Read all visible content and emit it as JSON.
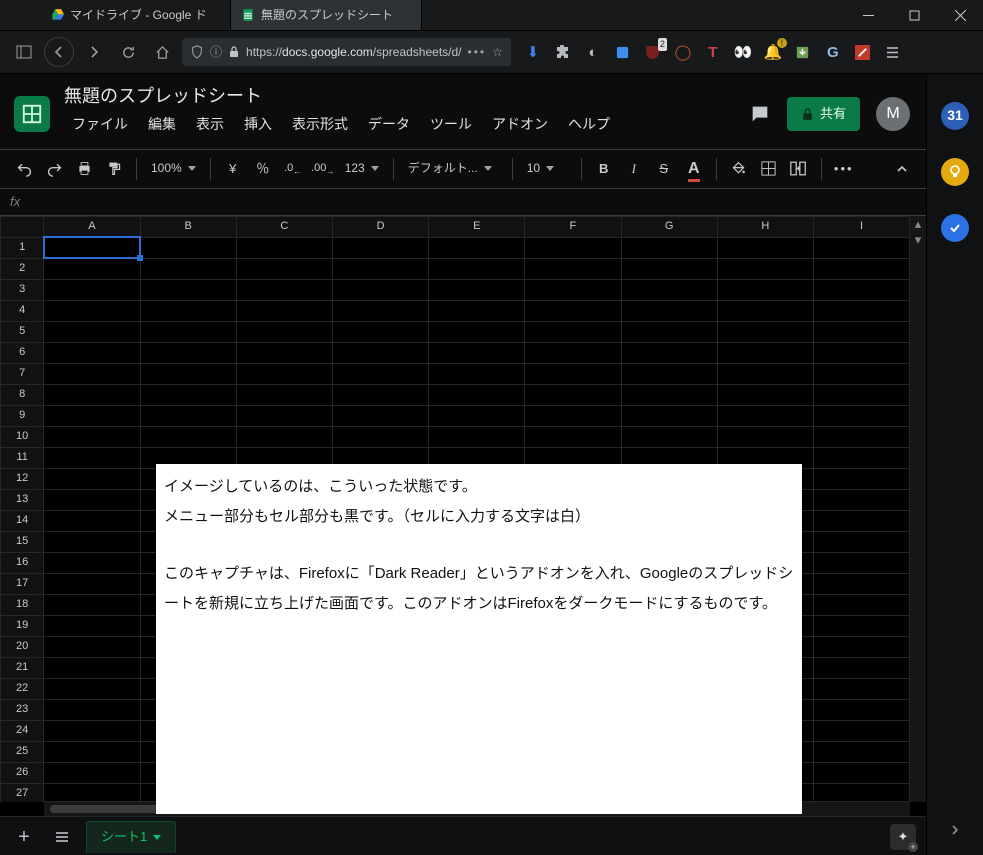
{
  "window": {
    "tabs": [
      {
        "label": "マイドライブ - Google ド",
        "icon": "drive"
      },
      {
        "label": "無題のスプレッドシート",
        "icon": "sheets"
      }
    ],
    "active_tab": 1
  },
  "browser": {
    "url_prefix": "https://",
    "url_host": "docs.google.com",
    "url_path": "/spreadsheets/d/",
    "ext_badges": {
      "ublock": "2",
      "bell": "!"
    }
  },
  "doc": {
    "title": "無題のスプレッドシート",
    "menus": [
      "ファイル",
      "編集",
      "表示",
      "挿入",
      "表示形式",
      "データ",
      "ツール",
      "アドオン",
      "ヘルプ"
    ],
    "share_label": "共有",
    "avatar_initial": "M"
  },
  "toolbar": {
    "zoom": "100%",
    "currency": "¥",
    "percent": "％",
    "dec_less": ".0",
    "dec_more": ".00",
    "numfmt": "123",
    "font": "デフォルト...",
    "size": "10"
  },
  "grid": {
    "columns": [
      "A",
      "B",
      "C",
      "D",
      "E",
      "F",
      "G",
      "H",
      "I"
    ],
    "rows": 27,
    "selected": "A1"
  },
  "overlay": {
    "line1": "イメージしているのは、こういった状態です。",
    "line2": "メニュー部分もセル部分も黒です。（セルに入力する文字は白）",
    "line3": "このキャプチャは、Firefoxに「Dark Reader」というアドオンを入れ、Googleのスプレッドシートを新規に立ち上げた画面です。このアドオンはFirefoxをダークモードにするものです。"
  },
  "sheetbar": {
    "active": "シート1"
  },
  "fx_label": "fx"
}
